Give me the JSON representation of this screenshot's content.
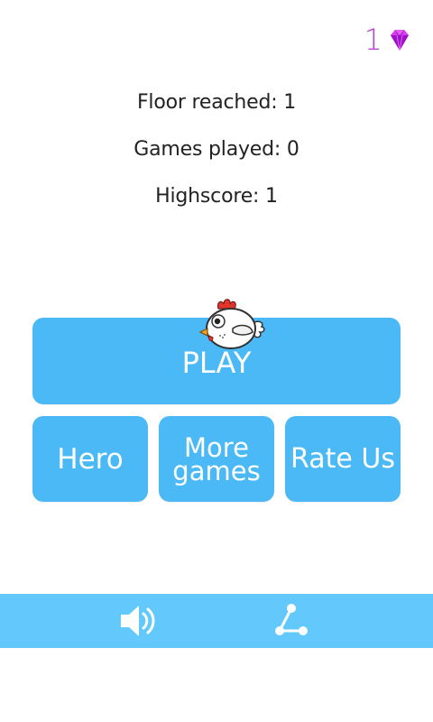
{
  "hud": {
    "gem_count": "1",
    "gem_icon": "gem-icon",
    "gem_color": "#b43fd0"
  },
  "stats": {
    "floor": "Floor reached: 1",
    "games": "Games played: 0",
    "highscore": "Highscore: 1"
  },
  "buttons": {
    "play": "PLAY",
    "hero": "Hero",
    "more": "More\ngames",
    "rate": "Rate Us"
  },
  "bottom_bar": {
    "sound_icon": "speaker-icon",
    "share_icon": "share-icon"
  },
  "colors": {
    "button": "#4bb9f6",
    "bar": "#63c8fb",
    "background": "#ffffff"
  }
}
